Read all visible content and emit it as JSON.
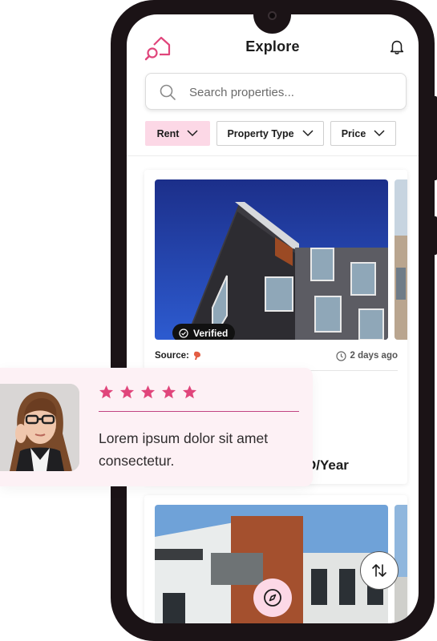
{
  "header": {
    "title": "Explore"
  },
  "search": {
    "placeholder": "Search properties..."
  },
  "filters": [
    {
      "label": "Rent",
      "active": true
    },
    {
      "label": "Property Type",
      "active": false
    },
    {
      "label": "Price",
      "active": false
    }
  ],
  "listings": [
    {
      "badge": "Verified",
      "source_label": "Source:",
      "posted": "2 days ago",
      "price_visible": "D/Year"
    }
  ],
  "review": {
    "rating": 5,
    "text": "Lorem ipsum dolor sit amet consectetur."
  },
  "colors": {
    "brand_pink": "#e0457b",
    "chip_active_bg": "#fcd8e6",
    "review_bg": "#fdf1f5",
    "star": "#e0457b"
  },
  "icons": [
    "home-search-logo-icon",
    "bell-icon",
    "search-icon",
    "chevron-down-icon",
    "verified-check-icon",
    "clock-icon",
    "source-logo-icon",
    "star-icon",
    "compass-icon",
    "sort-arrows-icon"
  ]
}
